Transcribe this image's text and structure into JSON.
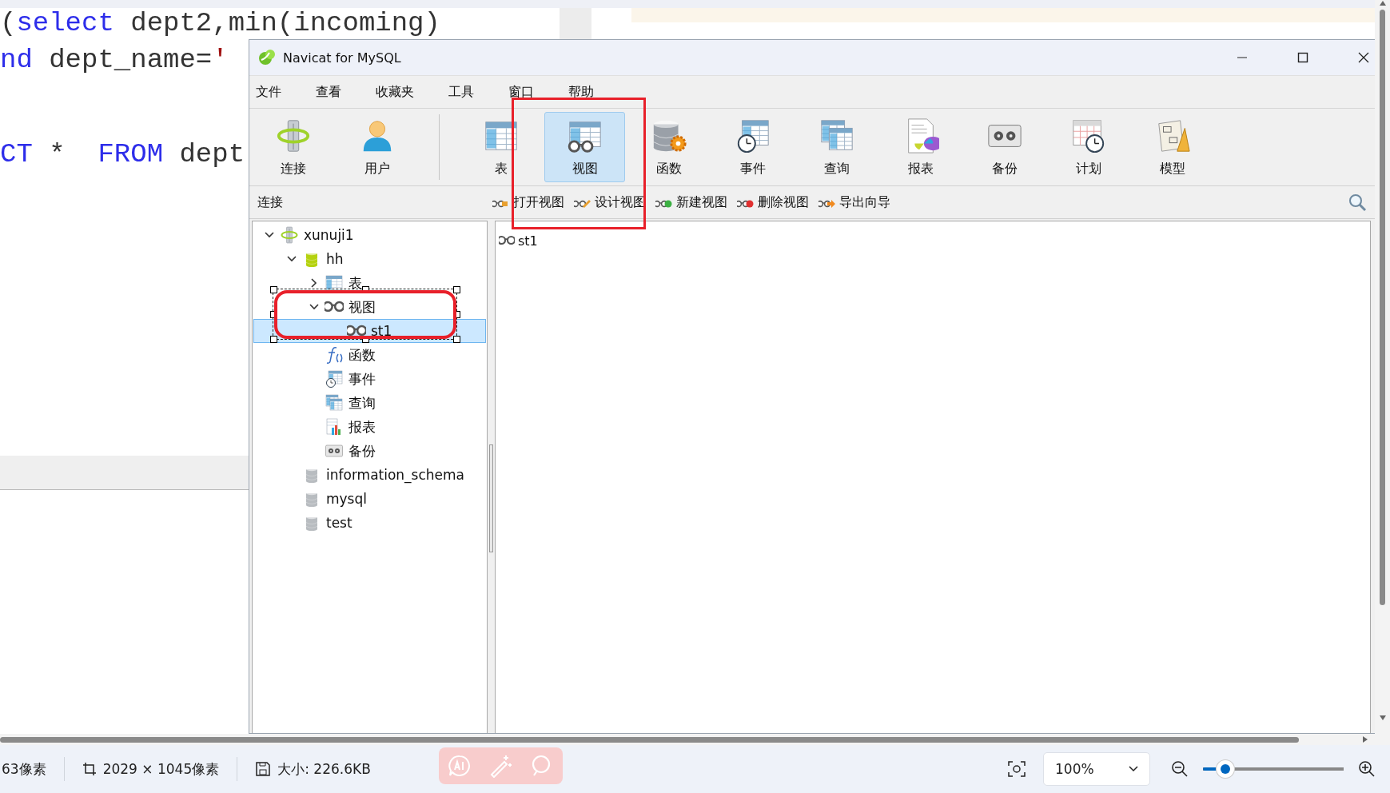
{
  "editor": {
    "lines": [
      [
        {
          "kind": "plain",
          "text": "("
        },
        {
          "kind": "keyword",
          "text": "select"
        },
        {
          "kind": "plain",
          "text": " dept2,min(incoming)"
        }
      ],
      [
        {
          "kind": "keyword",
          "text": "nd"
        },
        {
          "kind": "plain",
          "text": " dept_name="
        },
        {
          "kind": "string",
          "text": "'"
        }
      ],
      [
        {
          "kind": "keyword",
          "text": "CT"
        },
        {
          "kind": "plain",
          "text": " *  "
        },
        {
          "kind": "keyword",
          "text": "FROM"
        },
        {
          "kind": "plain",
          "text": " dept"
        }
      ]
    ]
  },
  "window": {
    "title": "Navicat for MySQL"
  },
  "menu": [
    "文件",
    "查看",
    "收藏夹",
    "工具",
    "窗口",
    "帮助"
  ],
  "toolbar": [
    {
      "label": "连接",
      "kind": "connection",
      "selected": false
    },
    {
      "label": "用户",
      "kind": "user",
      "selected": false
    },
    {
      "label": "表",
      "kind": "table",
      "selected": false
    },
    {
      "label": "视图",
      "kind": "view",
      "selected": true
    },
    {
      "label": "函数",
      "kind": "function",
      "selected": false
    },
    {
      "label": "事件",
      "kind": "event",
      "selected": false
    },
    {
      "label": "查询",
      "kind": "query",
      "selected": false
    },
    {
      "label": "报表",
      "kind": "report",
      "selected": false
    },
    {
      "label": "备份",
      "kind": "backup",
      "selected": false
    },
    {
      "label": "计划",
      "kind": "schedule",
      "selected": false
    },
    {
      "label": "模型",
      "kind": "model",
      "selected": false
    }
  ],
  "object_bar": {
    "title": "连接",
    "actions": [
      {
        "label": "打开视图",
        "kind": "open"
      },
      {
        "label": "设计视图",
        "kind": "design"
      },
      {
        "label": "新建视图",
        "kind": "new"
      },
      {
        "label": "删除视图",
        "kind": "delete"
      },
      {
        "label": "导出向导",
        "kind": "export"
      }
    ]
  },
  "tree": [
    {
      "label": "xunuji1",
      "kind": "connection",
      "expanded": true,
      "selected": false,
      "children": [
        {
          "label": "hh",
          "kind": "database_open",
          "expanded": true,
          "selected": false,
          "children": [
            {
              "label": "表",
              "kind": "table",
              "expanded": false,
              "selected": false
            },
            {
              "label": "视图",
              "kind": "view",
              "expanded": true,
              "selected": false,
              "children": [
                {
                  "label": "st1",
                  "kind": "view",
                  "selected": true
                }
              ]
            },
            {
              "label": "函数",
              "kind": "function",
              "selected": false
            },
            {
              "label": "事件",
              "kind": "event",
              "selected": false
            },
            {
              "label": "查询",
              "kind": "query",
              "selected": false
            },
            {
              "label": "报表",
              "kind": "report",
              "selected": false
            },
            {
              "label": "备份",
              "kind": "backup",
              "selected": false
            }
          ]
        },
        {
          "label": "information_schema",
          "kind": "database",
          "selected": false
        },
        {
          "label": "mysql",
          "kind": "database",
          "selected": false
        },
        {
          "label": "test",
          "kind": "database",
          "selected": false
        }
      ]
    }
  ],
  "objects": [
    {
      "name": "st1",
      "kind": "view"
    }
  ],
  "status_bar": {
    "pixel_info": "63像素",
    "dimensions": "2029 × 1045像素",
    "file_size": "大小: 226.6KB",
    "zoom": "100%",
    "zoom_slider": {
      "level": 0.16
    }
  }
}
